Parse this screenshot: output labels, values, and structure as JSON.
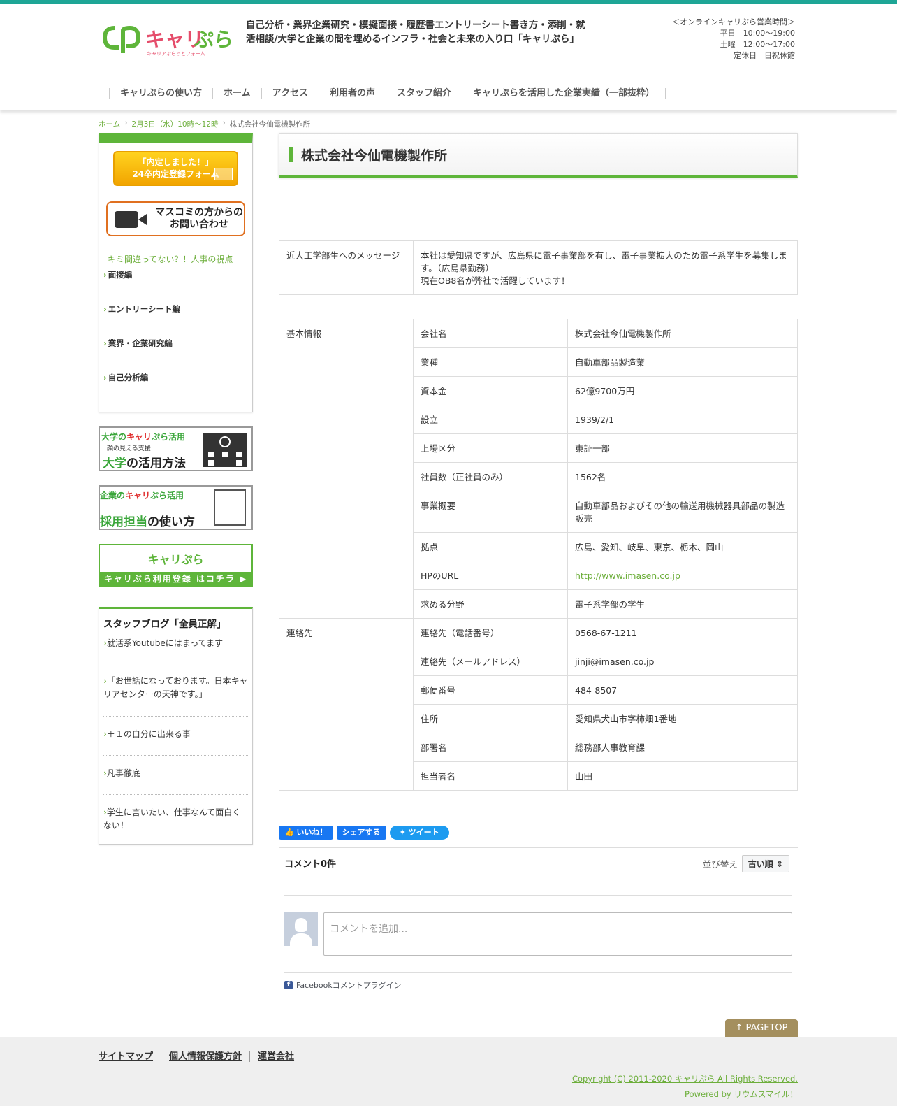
{
  "header": {
    "logo_text": "キャリぷら",
    "logo_sub": "キャリアぷらっとフォーム",
    "tagline": "自己分析・業界企業研究・模擬面接・履歴書エントリーシート書き方・添削・就活相談/大学と企業の間を埋めるインフラ・社会と未来の入り口「キャリぷら」",
    "hours_title": "＜オンラインキャリぷら営業時間＞",
    "hours_weekday": "平日　10:00〜19:00",
    "hours_saturday": "土曜　12:00〜17:00",
    "hours_closed": "定休日　日祝休館"
  },
  "nav": [
    "キャリぷらの使い方",
    "ホーム",
    "アクセス",
    "利用者の声",
    "スタッフ紹介",
    "キャリぷらを活用した企業実績（一部抜粋）"
  ],
  "breadcrumb": {
    "home": "ホーム",
    "event": "2月3日（水）10時〜12時",
    "current": "株式会社今仙電機製作所"
  },
  "sidebar": {
    "naitei_line1": "「内定しました！」",
    "naitei_line2": "24卒内定登録フォーム",
    "media_line1": "マスコミの方からの",
    "media_line2": "お問い合わせ",
    "heading": "キミ間違ってない？！人事の視点",
    "items": [
      "面接編",
      "エントリーシート編",
      "業界・企業研究編",
      "自己分析編"
    ],
    "banner_univ_1a": "大学の",
    "banner_univ_1b": "キャリ",
    "banner_univ_1c": "ぷら",
    "banner_univ_1d": "活用",
    "banner_univ_2": "顔の見える支援",
    "banner_univ_3a": "大学",
    "banner_univ_3b": "の活用方法",
    "banner_corp_1a": "企業の",
    "banner_corp_1b": "キャリ",
    "banner_corp_1c": "ぷら",
    "banner_corp_1d": "活用",
    "banner_corp_3a": "採用担当",
    "banner_corp_3b": "の使い方",
    "banner_reg_logo": "キャリぷら",
    "banner_reg_bar": "キャリぷら利用登録 はコチラ ▶",
    "blog_title": "スタッフブログ「全員正解」",
    "blog_items": [
      "就活系Youtubeにはまってます",
      "「お世話になっております。日本キャリアセンターの天神です。」",
      "＋１の自分に出来る事",
      "凡事徹底",
      "学生に言いたい、仕事なんて面白くない！"
    ]
  },
  "main": {
    "title": "株式会社今仙電機製作所",
    "message_label": "近大工学部生へのメッセージ",
    "message_line1": "本社は愛知県ですが、広島県に電子事業部を有し、電子事業拡大のため電子系学生を募集します。（広島県勤務）",
    "message_line2": "現在OB8名が弊社で活躍しています！",
    "section_basic": "基本情報",
    "section_contact": "連絡先",
    "basic_rows": [
      {
        "label": "会社名",
        "value": "株式会社今仙電機製作所"
      },
      {
        "label": "業種",
        "value": "自動車部品製造業"
      },
      {
        "label": "資本金",
        "value": "62億9700万円"
      },
      {
        "label": "設立",
        "value": "1939/2/1"
      },
      {
        "label": "上場区分",
        "value": "東証一部"
      },
      {
        "label": "社員数（正社員のみ）",
        "value": "1562名"
      },
      {
        "label": "事業概要",
        "value": "自動車部品およびその他の輸送用機械器具部品の製造販売"
      },
      {
        "label": "拠点",
        "value": "広島、愛知、岐阜、東京、栃木、岡山"
      },
      {
        "label": "HPのURL",
        "value": "http://www.imasen.co.jp"
      },
      {
        "label": "求める分野",
        "value": "電子系学部の学生"
      }
    ],
    "contact_rows": [
      {
        "label": "連絡先（電話番号）",
        "value": "0568-67-1211"
      },
      {
        "label": "連絡先（メールアドレス）",
        "value": "jinji@imasen.co.jp"
      },
      {
        "label": "郵便番号",
        "value": "484-8507"
      },
      {
        "label": "住所",
        "value": "愛知県犬山市字柿畑1番地"
      },
      {
        "label": "部署名",
        "value": "総務部人事教育課"
      },
      {
        "label": "担当者名",
        "value": "山田"
      }
    ]
  },
  "social": {
    "like": "いいね！",
    "share": "シェアする",
    "tweet": "ツイート"
  },
  "comments": {
    "count": "コメント0件",
    "sort_label": "並び替え",
    "sort_value": "古い順 ⇕",
    "placeholder": "コメントを追加...",
    "plugin": "Facebookコメントプラグイン"
  },
  "pagetop": "↑ PAGETOP",
  "footer": {
    "links": [
      "サイトマップ",
      "個人情報保護方針",
      "運営会社"
    ],
    "copyright": "Copyright (C) 2011-2020 キャリぷら All Rights Reserved.",
    "powered": "Powered by リウムスマイル！"
  },
  "colors": {
    "accent": "#5eb53a",
    "topbar": "#1ea696",
    "pagetop": "#a48f5e"
  }
}
